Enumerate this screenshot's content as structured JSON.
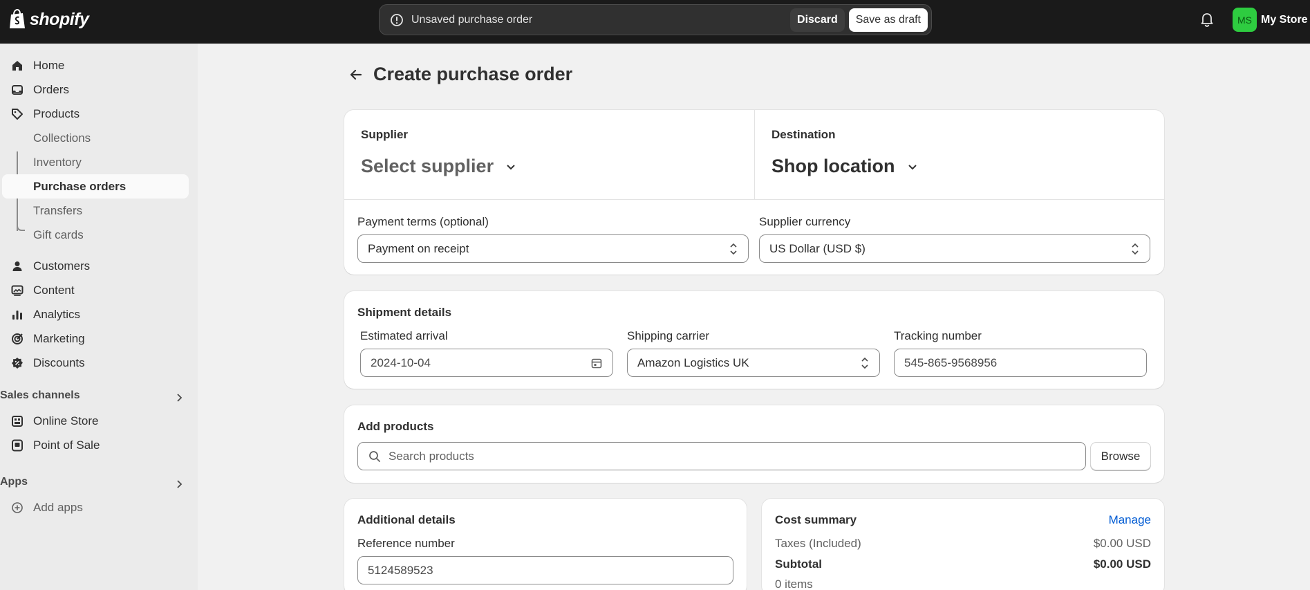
{
  "topbar": {
    "logo_text": "shopify",
    "savebar_text": "Unsaved purchase order",
    "discard_label": "Discard",
    "save_draft_label": "Save as draft",
    "avatar_initials": "MS",
    "store_name": "My Store",
    "avatar_color": "#2ecc40"
  },
  "sidebar": {
    "items": [
      {
        "label": "Home",
        "icon": "home-icon"
      },
      {
        "label": "Orders",
        "icon": "inbox-icon"
      },
      {
        "label": "Products",
        "icon": "tag-icon"
      },
      {
        "label": "Collections"
      },
      {
        "label": "Inventory"
      },
      {
        "label": "Purchase orders"
      },
      {
        "label": "Transfers"
      },
      {
        "label": "Gift cards"
      },
      {
        "label": "Customers",
        "icon": "person-icon"
      },
      {
        "label": "Content",
        "icon": "image-icon"
      },
      {
        "label": "Analytics",
        "icon": "bar-chart-icon"
      },
      {
        "label": "Marketing",
        "icon": "target-icon"
      },
      {
        "label": "Discounts",
        "icon": "discount-icon"
      }
    ],
    "sales_channels_label": "Sales channels",
    "channels": [
      {
        "label": "Online Store",
        "icon": "store-icon"
      },
      {
        "label": "Point of Sale",
        "icon": "pos-icon"
      }
    ],
    "apps_label": "Apps",
    "add_apps_label": "Add apps"
  },
  "page": {
    "title": "Create purchase order"
  },
  "supplier_card": {
    "supplier_label": "Supplier",
    "supplier_value": "Select supplier",
    "destination_label": "Destination",
    "destination_value": "Shop location",
    "payment_terms_label": "Payment terms (optional)",
    "payment_terms_value": "Payment on receipt",
    "currency_label": "Supplier currency",
    "currency_value": "US Dollar (USD $)"
  },
  "shipment": {
    "heading": "Shipment details",
    "arrival_label": "Estimated arrival",
    "arrival_value": "2024-10-04",
    "carrier_label": "Shipping carrier",
    "carrier_value": "Amazon Logistics UK",
    "tracking_label": "Tracking number",
    "tracking_value": "545-865-9568956"
  },
  "products": {
    "heading": "Add products",
    "search_placeholder": "Search products",
    "browse_label": "Browse"
  },
  "additional": {
    "heading": "Additional details",
    "reference_label": "Reference number",
    "reference_value": "5124589523"
  },
  "cost_summary": {
    "heading": "Cost summary",
    "manage_label": "Manage",
    "taxes_label": "Taxes (Included)",
    "taxes_value": "$0.00 USD",
    "subtotal_label": "Subtotal",
    "subtotal_value": "$0.00 USD",
    "items_label": "0 items"
  }
}
